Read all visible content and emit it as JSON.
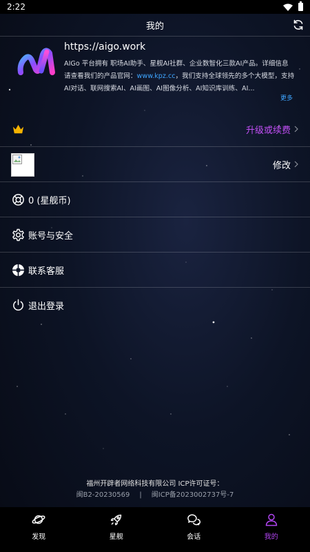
{
  "status_bar": {
    "time": "2:22"
  },
  "header": {
    "title": "我的"
  },
  "profile": {
    "url": "https://aigo.work",
    "desc_part1": "AIGo 平台拥有 职场AI助手、星舰AI社群、企业数智化三款AI产品。详细信息请查看我们的产品官网：",
    "desc_link": "www.kpz.cc",
    "desc_part2": "，我们支持全球领先的多个大模型，支持AI对话、联网搜索AI、AI画图、AI图像分析、AI知识库训练、AI...",
    "more": "更多"
  },
  "menu": {
    "upgrade_label": "升级或续费",
    "avatar_edit_label": "修改",
    "coins_label": "0 (星舰币)",
    "account_label": "账号与安全",
    "service_label": "联系客服",
    "logout_label": "退出登录"
  },
  "footer": {
    "company": "福州开辟者网络科技有限公司 ICP许可证号：",
    "license1": "闽B2-20230569",
    "separator": "|",
    "license2": "闽ICP备2023002737号-7"
  },
  "tabs": [
    {
      "label": "发现",
      "icon": "planet-icon"
    },
    {
      "label": "星舰",
      "icon": "rocket-icon"
    },
    {
      "label": "会话",
      "icon": "chat-icon"
    },
    {
      "label": "我的",
      "icon": "user-icon"
    }
  ],
  "colors": {
    "accent": "#b044f0",
    "upgrade": "#c24ff5",
    "link": "#3ea5ff",
    "crown": "#f5b300"
  }
}
